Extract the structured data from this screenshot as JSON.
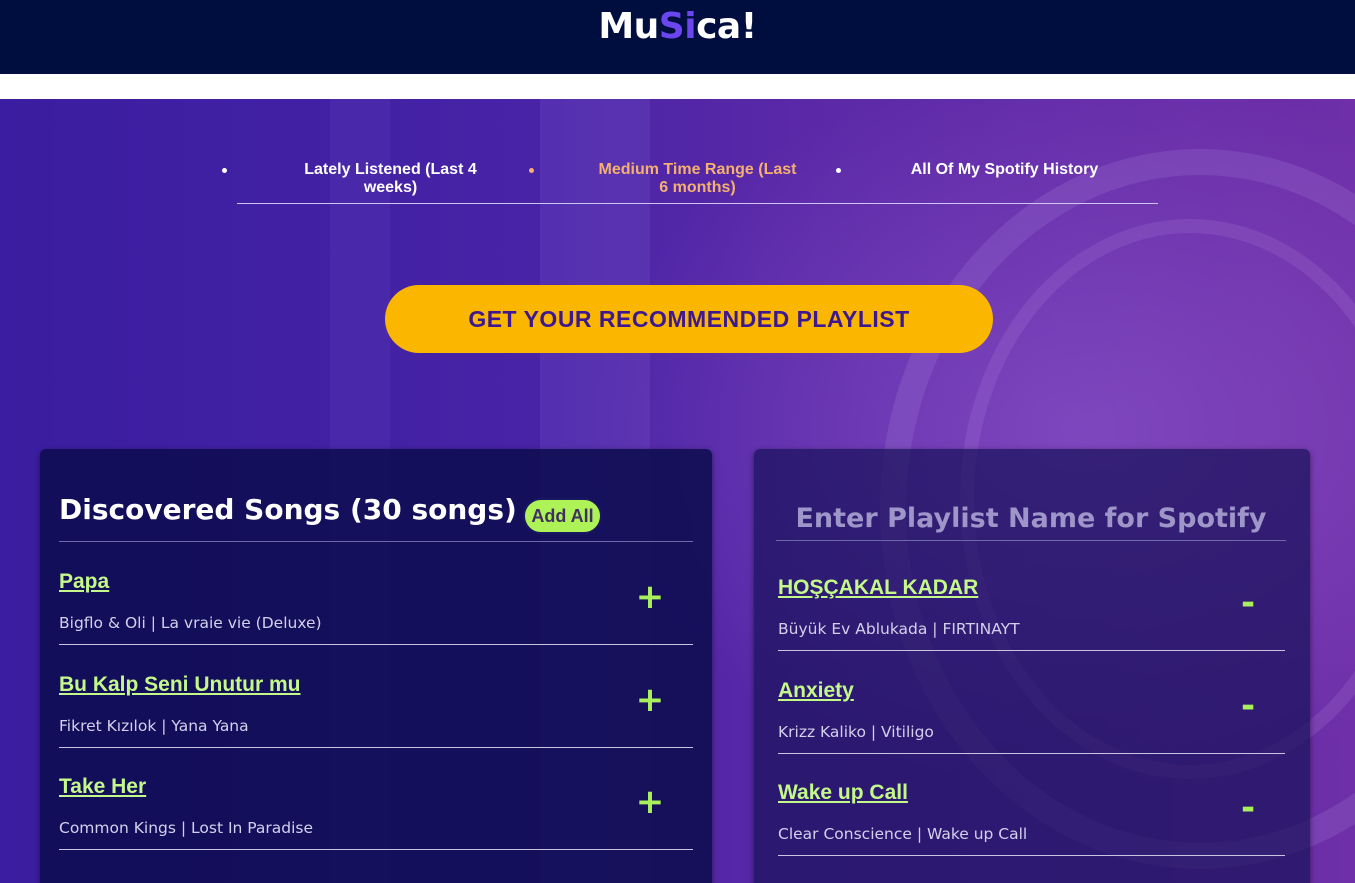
{
  "app": {
    "logo": {
      "part1": "Mu",
      "accent": "Si",
      "part2": "ca!"
    }
  },
  "tabs": [
    {
      "label": "Lately Listened (Last 4 weeks)",
      "active": false
    },
    {
      "label": "Medium Time Range (Last 6 months)",
      "active": true
    },
    {
      "label": "All Of My Spotify History",
      "active": false
    }
  ],
  "cta": {
    "label": "GET YOUR RECOMMENDED PLAYLIST"
  },
  "discovered": {
    "title": "Discovered Songs (30 songs)",
    "add_all_label": "Add All",
    "action_symbol": "+",
    "songs": [
      {
        "title": "Papa",
        "artist": "Bigflo & Oli",
        "album": "La vraie vie (Deluxe)",
        "subtitle": "Bigflo & Oli | La vraie vie (Deluxe)"
      },
      {
        "title": "Bu Kalp Seni Unutur mu",
        "artist": "Fikret Kızılok",
        "album": "Yana Yana",
        "subtitle": "Fikret Kızılok | Yana Yana"
      },
      {
        "title": "Take Her",
        "artist": "Common Kings",
        "album": "Lost In Paradise",
        "subtitle": "Common Kings | Lost In Paradise"
      }
    ]
  },
  "playlist": {
    "name_placeholder": "Enter Playlist Name for Spotify",
    "action_symbol": "-",
    "songs": [
      {
        "title": "HOŞÇAKAL KADAR",
        "artist": "Büyük Ev Ablukada",
        "album": "FIRTINAYT",
        "subtitle": "Büyük Ev Ablukada | FIRTINAYT"
      },
      {
        "title": "Anxiety",
        "artist": "Krizz Kaliko",
        "album": "Vitiligo",
        "subtitle": "Krizz Kaliko | Vitiligo"
      },
      {
        "title": "Wake up Call",
        "artist": "Clear Conscience",
        "album": "Wake up Call",
        "subtitle": "Clear Conscience | Wake up Call"
      }
    ]
  },
  "colors": {
    "header_bg": "#000d3f",
    "logo_accent": "#6b46ee",
    "active_tab": "#f5b070",
    "cta_bg": "#fbb700",
    "cta_text": "#3d1890",
    "song_title": "#c4f98a",
    "action_green": "#a9f05a"
  }
}
